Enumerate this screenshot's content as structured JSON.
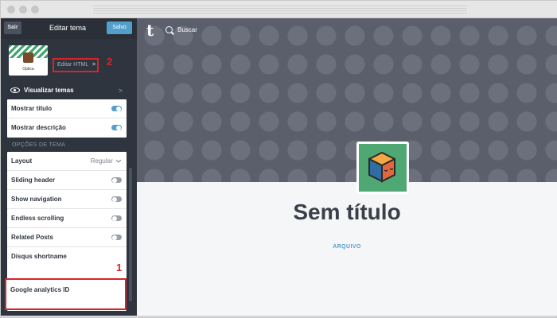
{
  "sidebar": {
    "exit_label": "Sair",
    "title": "Editar tema",
    "saved_label": "Salvo",
    "theme_name": "Optica",
    "edit_html_label": "Editar HTML",
    "edit_html_chevron": ">",
    "annotation_2": "2",
    "preview_themes_label": "Visualizar temas",
    "preview_themes_chevron": ">",
    "display_options": [
      {
        "label": "Mostrar título",
        "state": "on"
      },
      {
        "label": "Mostrar descrição",
        "state": "on"
      }
    ],
    "section_heading": "OPÇÕES DE TEMA",
    "layout": {
      "label": "Layout",
      "value": "Regular"
    },
    "theme_options": [
      {
        "label": "Sliding header",
        "state": "off"
      },
      {
        "label": "Show navigation",
        "state": "off"
      },
      {
        "label": "Endless scrolling",
        "state": "off"
      },
      {
        "label": "Related Posts",
        "state": "off"
      }
    ],
    "disqus_label": "Disqus shortname",
    "annotation_1": "1",
    "ga_label": "Google analytics ID"
  },
  "preview": {
    "search_label": "Buscar",
    "blog_title": "Sem título",
    "archive_link": "ARQUIVO"
  },
  "colors": {
    "accent": "#529ecc",
    "annotation": "#d6252b",
    "sidebar_bg": "#2f353e",
    "avatar_bg": "#4fa874"
  },
  "icons": [
    "eye-icon",
    "search-icon",
    "tumblr-icon",
    "chevron-right-icon",
    "chevron-down-icon"
  ]
}
